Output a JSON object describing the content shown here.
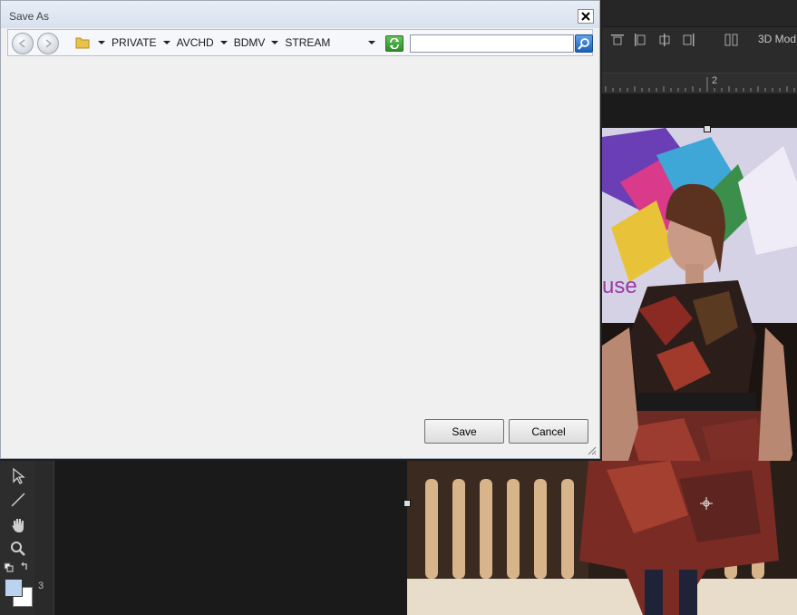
{
  "dialog": {
    "title": "Save As",
    "breadcrumb": [
      "PRIVATE",
      "AVCHD",
      "BDMV",
      "STREAM"
    ],
    "search": {
      "value": "",
      "placeholder": ""
    },
    "buttons": {
      "save": "Save",
      "cancel": "Cancel"
    }
  },
  "background_app": {
    "mode_label": "3D Mod",
    "ruler_horizontal_number": "2",
    "ruler_vertical_number": "3"
  },
  "colors": {
    "dialog_bg": "#f0f0f0",
    "title_bar": "#d7e1ee",
    "app_bg": "#1f1f1f",
    "refresh_green": "#2e8e2a",
    "search_blue": "#1d5fb8"
  },
  "icons": {
    "back": "back-arrow-icon",
    "forward": "forward-arrow-icon",
    "folder": "folder-icon",
    "refresh": "refresh-icon",
    "search": "search-icon",
    "close": "close-icon"
  }
}
